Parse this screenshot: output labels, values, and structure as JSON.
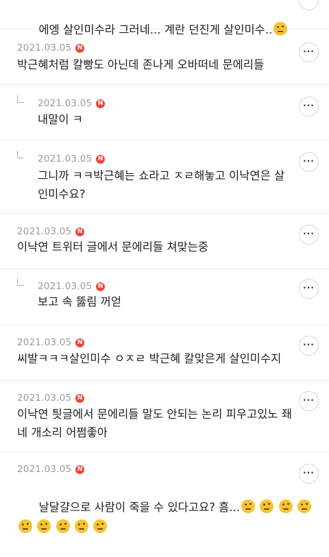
{
  "comments": [
    {
      "id": 0,
      "date": "",
      "badge": "",
      "text": "에엥 살인미수라 그러네... 계란 던진게 살인미수..",
      "emoji_count": 1,
      "emoji_type": "face-with-monocle"
    },
    {
      "id": 1,
      "date": "2021.03.05",
      "badge": "N",
      "text": "박근혜처럼 칼빵도 아닌데 존나게 오바떠네 문에리들",
      "reply": false
    },
    {
      "id": 2,
      "date": "2021.03.05",
      "badge": "N",
      "text": "내말이 ㅋ",
      "reply": true
    },
    {
      "id": 3,
      "date": "2021.03.05",
      "badge": "N",
      "text": "그니까 ㅋㅋ박근혜는 쇼라고 ㅈㄹ해놓고 이낙연은 살\n인미수요?",
      "reply": true
    },
    {
      "id": 4,
      "date": "2021.03.05",
      "badge": "N",
      "text": "이낙연 트위터 글에서 문에리들 쳐맞는중",
      "reply": false
    },
    {
      "id": 5,
      "date": "2021.03.05",
      "badge": "N",
      "text": "보고 속 뚫림 꺼얻",
      "reply": true
    },
    {
      "id": 6,
      "date": "2021.03.05",
      "badge": "N",
      "text": "씨발ㅋㅋㅋ살인미수 ㅇㅈㄹ 박근혜 칼맞은게 살인미수지",
      "reply": false
    },
    {
      "id": 7,
      "date": "2021.03.05",
      "badge": "N",
      "text": "이낙연 틧글에서 문에리들 말도 안되는 논리 피우고있노 좨\n네 개소리 어쩜좋아",
      "reply": false
    },
    {
      "id": 8,
      "date": "2021.03.05",
      "badge": "N",
      "text": "날달걀으로 사람이 죽을 수 있다고요? 흠...",
      "reply": false,
      "emoji_type": "thinking-face",
      "emoji_count_line1": 4,
      "emoji_count_line2": 5
    }
  ],
  "more_label": "···"
}
